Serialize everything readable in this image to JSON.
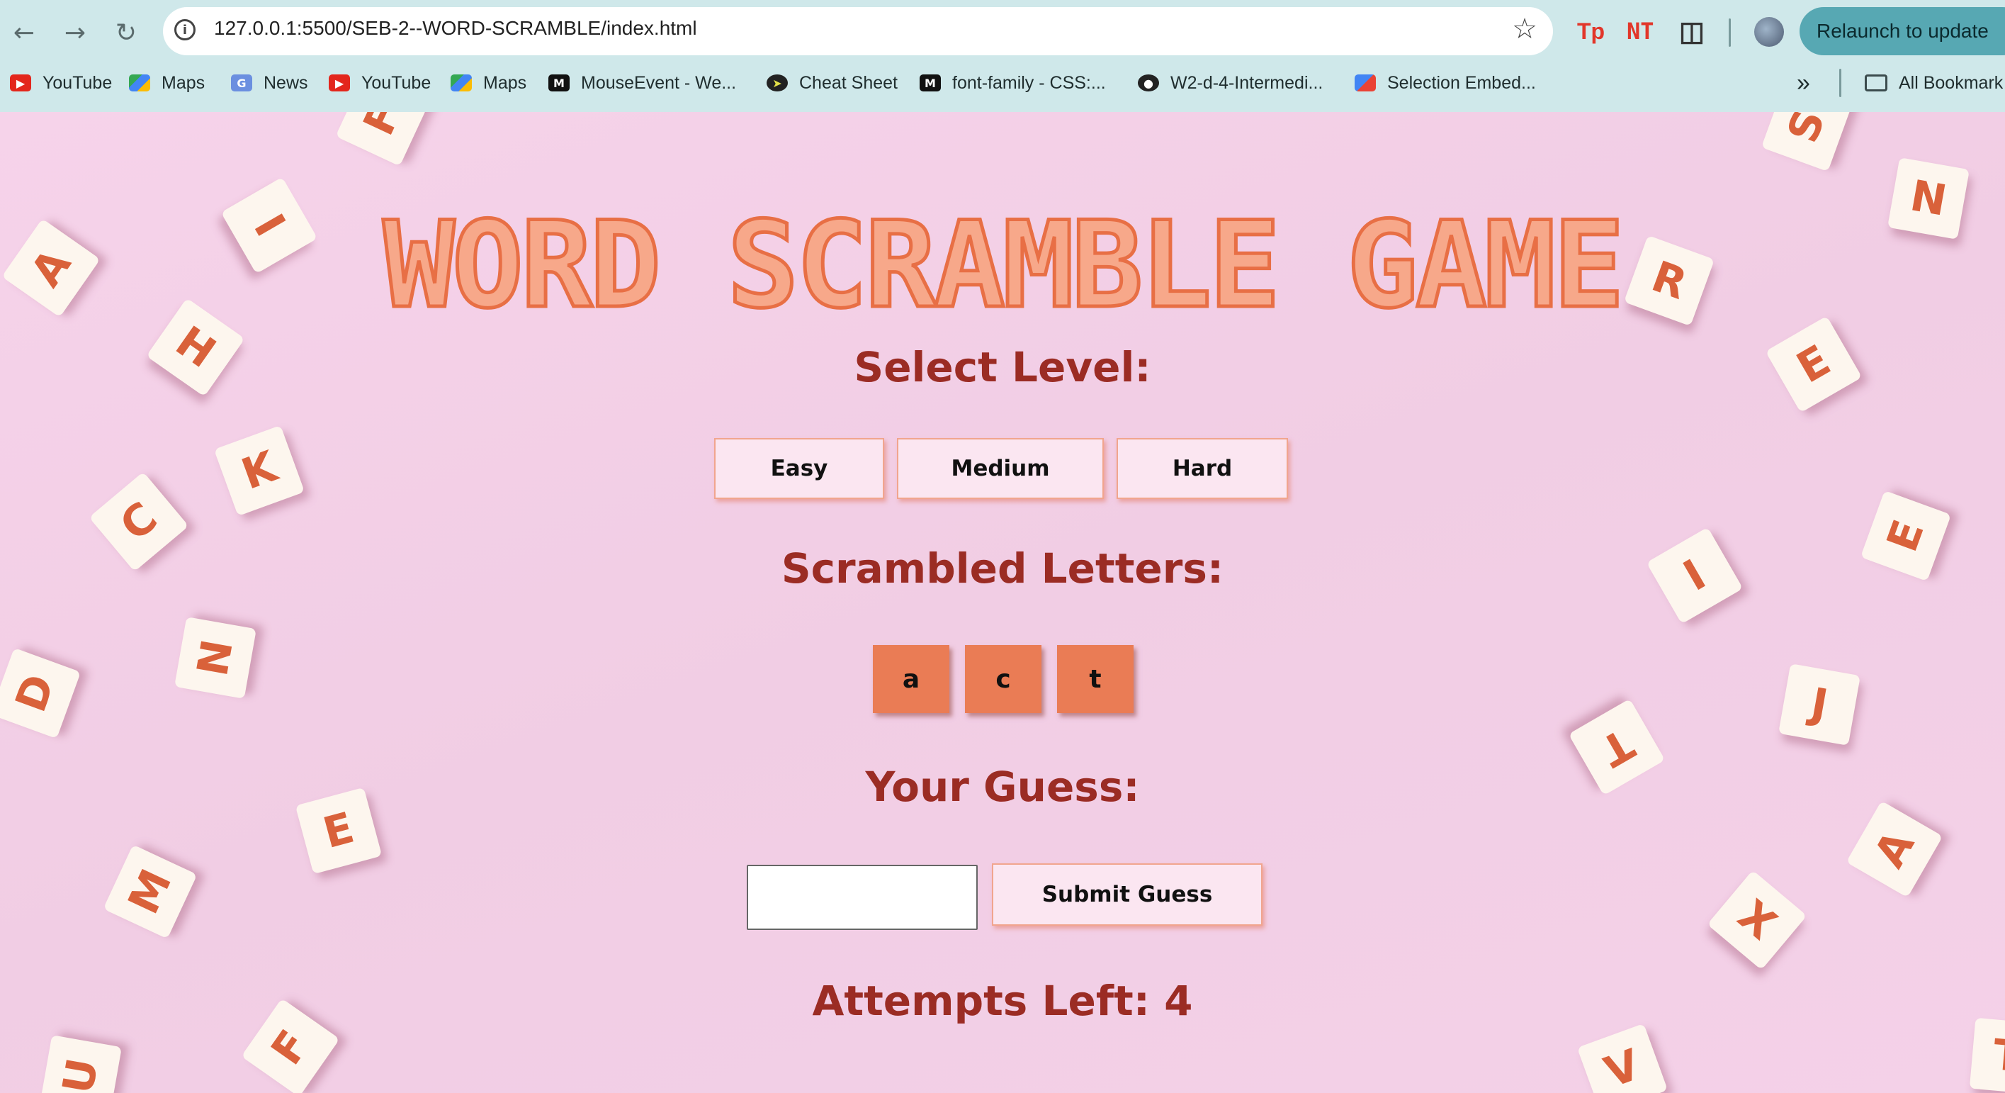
{
  "browser": {
    "url": "127.0.0.1:5500/SEB-2--WORD-SCRAMBLE/index.html",
    "relaunch_label": "Relaunch to update",
    "extensions": [
      "Tp",
      "NT"
    ],
    "bookmarks": [
      "YouTube",
      "Maps",
      "News",
      "YouTube",
      "Maps",
      "MouseEvent - We...",
      "Cheat Sheet",
      "font-family - CSS:...",
      "W2-d-4-Intermedi...",
      "Selection Embed..."
    ],
    "overflow_label": "»",
    "all_bookmarks_label": "All Bookmark"
  },
  "game": {
    "title": "Word Scramble Game",
    "select_level_heading": "Select Level:",
    "levels": [
      "Easy",
      "Medium",
      "Hard"
    ],
    "scrambled_heading": "Scrambled Letters:",
    "letters": [
      "a",
      "c",
      "t"
    ],
    "guess_heading": "Your Guess:",
    "guess_value": "",
    "submit_label": "Submit Guess",
    "attempts_text": "Attempts Left: 4"
  },
  "background_tiles": [
    "F",
    "S",
    "N",
    "I",
    "A",
    "R",
    "H",
    "E",
    "K",
    "C",
    "E",
    "I",
    "N",
    "J",
    "D",
    "T",
    "E",
    "A",
    "M",
    "X",
    "U",
    "F",
    "V",
    "T"
  ],
  "colors": {
    "page_background": "#f3d0e6",
    "title_orange": "#e86f45",
    "heading_maroon": "#9b2c24",
    "letter_tile": "#ea7c55",
    "button_bg": "#fbe6f1",
    "chrome_bar": "#cfe8ea",
    "relaunch_button": "#57a8b3"
  }
}
